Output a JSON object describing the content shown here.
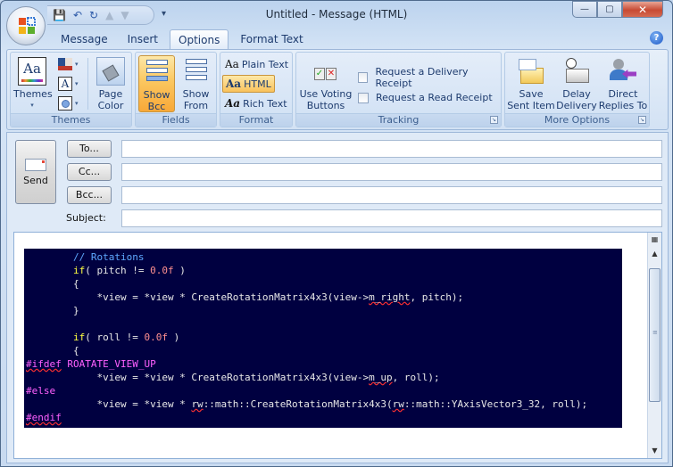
{
  "window": {
    "title": "Untitled - Message (HTML)",
    "minimize": "—",
    "restore": "▢",
    "close": "✕"
  },
  "qat": {
    "save": "💾",
    "undo": "↶",
    "redo": "↻",
    "up": "▲",
    "down": "▼",
    "more": "▾"
  },
  "tabs": [
    {
      "label": "Message"
    },
    {
      "label": "Insert"
    },
    {
      "label": "Options",
      "active": true
    },
    {
      "label": "Format Text"
    }
  ],
  "help": "?",
  "ribbon": {
    "themes": {
      "label": "Themes",
      "themes_btn": "Themes",
      "page_color": "Page Color",
      "caret": "▾"
    },
    "fields": {
      "label": "Fields",
      "show_bcc": "Show Bcc",
      "show_from": "Show From"
    },
    "format": {
      "label": "Format",
      "plain": "Plain Text",
      "html": "HTML",
      "rich": "Rich Text",
      "aa": "Aa"
    },
    "tracking": {
      "label": "Tracking",
      "voting": "Use Voting Buttons",
      "delivery": "Request a Delivery Receipt",
      "read": "Request a Read Receipt"
    },
    "more": {
      "label": "More Options",
      "save_sent": "Save Sent Item",
      "delay": "Delay Delivery",
      "direct": "Direct Replies To"
    }
  },
  "compose": {
    "send": "Send",
    "to": "To...",
    "cc": "Cc...",
    "bcc": "Bcc...",
    "subject": "Subject:",
    "to_value": "",
    "cc_value": "",
    "bcc_value": "",
    "subject_value": ""
  },
  "code": {
    "l1": "        // Rotations",
    "l2a": "        ",
    "l2kw": "if",
    "l2b": "( pitch != ",
    "l2n": "0.0f",
    "l2c": " )",
    "l3": "        {",
    "l4a": "            *view = *view * CreateRotationMatrix4x3(view->",
    "l4s": "m_right",
    "l4b": ", pitch);",
    "l5": "        }",
    "l6": "",
    "l7a": "        ",
    "l7kw": "if",
    "l7b": "( roll != ",
    "l7n": "0.0f",
    "l7c": " )",
    "l8": "        {",
    "l9s": "#ifdef",
    "l9b": " ROATATE_VIEW_UP",
    "l10a": "            *view = *view * CreateRotationMatrix4x3(view->",
    "l10s": "m_up",
    "l10b": ", roll);",
    "l11": "#else",
    "l12a": "            *view = *view * ",
    "l12s": "rw",
    "l12b": "::math::CreateRotationMatrix4x3(",
    "l12s2": "rw",
    "l12c": "::math::YAxisVector3_32, roll);",
    "l13": "#endif"
  }
}
